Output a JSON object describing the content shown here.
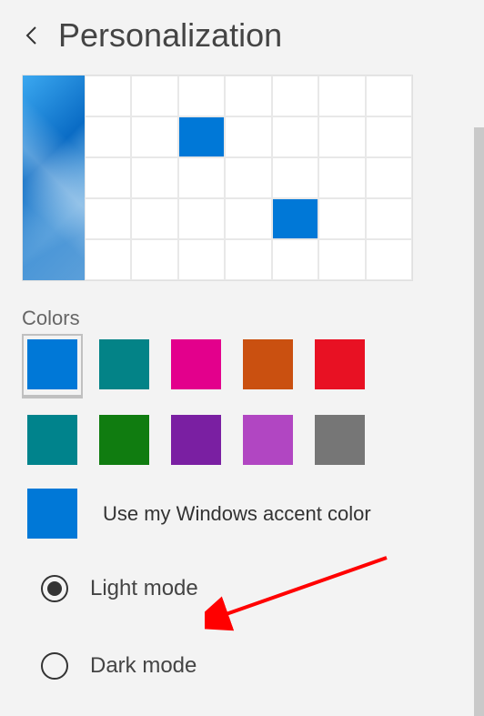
{
  "header": {
    "title": "Personalization"
  },
  "colors": {
    "label": "Colors",
    "row1": [
      {
        "hex": "#0078d7",
        "selected": true
      },
      {
        "hex": "#038387",
        "selected": false
      },
      {
        "hex": "#e3008c",
        "selected": false
      },
      {
        "hex": "#ca5010",
        "selected": false
      },
      {
        "hex": "#e81123",
        "selected": false
      }
    ],
    "row2": [
      {
        "hex": "#00838c",
        "selected": false
      },
      {
        "hex": "#107c10",
        "selected": false
      },
      {
        "hex": "#7a1fa2",
        "selected": false
      },
      {
        "hex": "#b146c2",
        "selected": false
      },
      {
        "hex": "#767676",
        "selected": false
      }
    ]
  },
  "accent": {
    "preview_hex": "#0078d7",
    "label": "Use my Windows accent color"
  },
  "mode": {
    "light": {
      "label": "Light mode",
      "selected": true
    },
    "dark": {
      "label": "Dark mode",
      "selected": false
    }
  },
  "preview": {
    "accent_hex": "#0078d7"
  },
  "annotation": {
    "color": "#ff0000"
  }
}
